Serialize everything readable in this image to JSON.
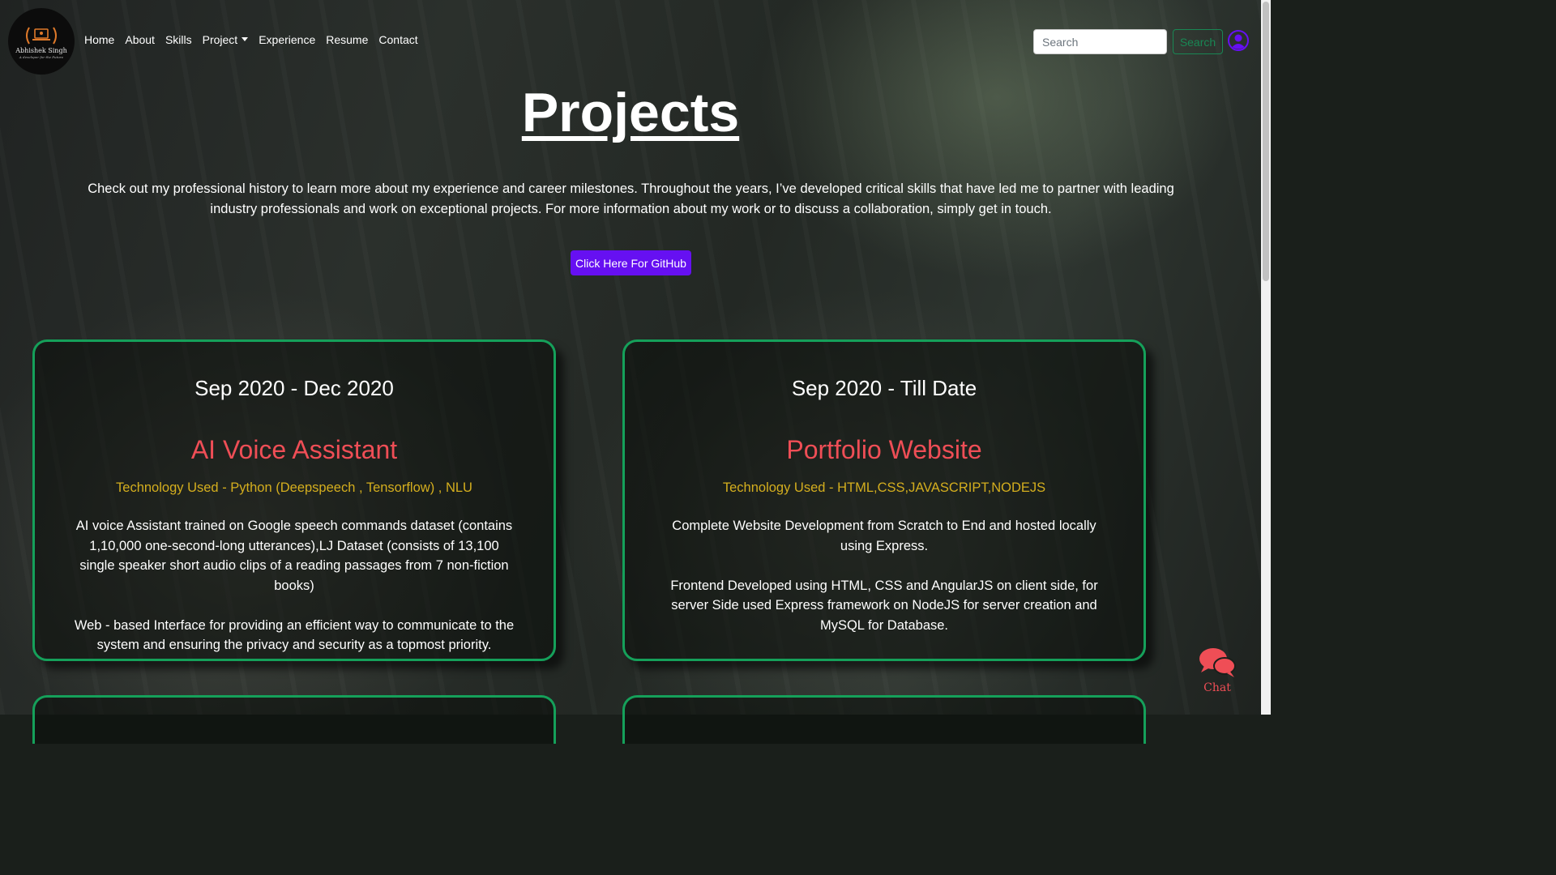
{
  "brand": {
    "name": "Abhishek Singh",
    "tagline": "A developer for the Future"
  },
  "nav": {
    "items": [
      {
        "label": "Home"
      },
      {
        "label": "About"
      },
      {
        "label": "Skills"
      },
      {
        "label": "Project"
      },
      {
        "label": "Experience"
      },
      {
        "label": "Resume"
      },
      {
        "label": "Contact"
      }
    ],
    "search_placeholder": "Search",
    "search_button": "Search"
  },
  "hero": {
    "title": "Projects",
    "intro": "Check out my professional history to learn more about my experience and career milestones. Throughout the years, I’ve developed critical skills that have led me to partner with leading industry professionals and work on exceptional projects. For more information about my work or to discuss a collaboration, simply get in touch.",
    "github_button": "Click Here For GitHub"
  },
  "projects": [
    {
      "date": "Sep 2020 - Dec 2020",
      "title": "AI Voice Assistant",
      "tech": "Technology Used - Python (Deepspeech , Tensorflow) , NLU",
      "desc1": "AI voice Assistant trained on Google speech commands dataset (contains 1,10,000 one-second-long utterances),LJ Dataset (consists of 13,100 single speaker short audio clips of a reading passages from 7 non-fiction books)",
      "desc2": "Web - based Interface for providing an efficient way to communicate to the system and ensuring the privacy and security as a topmost priority."
    },
    {
      "date": "Sep 2020 - Till Date",
      "title": "Portfolio Website",
      "tech": "Technology Used - HTML,CSS,JAVASCRIPT,NODEJS",
      "desc1": "Complete Website Development from Scratch to End and hosted locally using Express.",
      "desc2": "Frontend Developed using HTML, CSS and AngularJS on client side, for server Side used Express framework on NodeJS for server creation and MySQL for Database."
    }
  ],
  "chat": {
    "label": "Chat",
    "icon": "chat-bubbles-icon"
  },
  "colors": {
    "accent_green": "#15a05a",
    "project_title": "#ef4e56",
    "tech_text": "#d4ae1e",
    "github_button": "#6610f2",
    "user_icon": "#6610f2"
  }
}
